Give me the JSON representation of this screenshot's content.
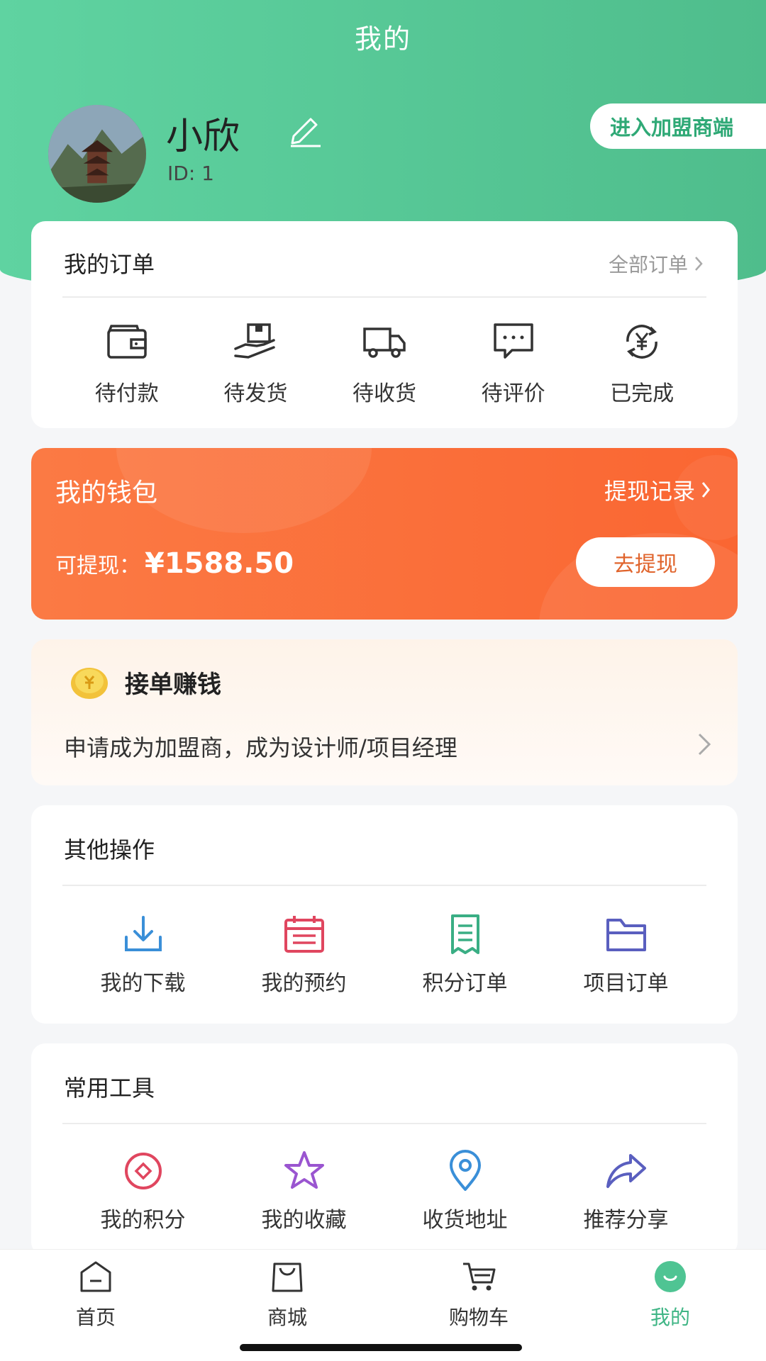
{
  "header": {
    "title": "我的",
    "user_name": "小欣",
    "user_id": "ID: 1",
    "merchant_button": "进入加盟商端"
  },
  "orders": {
    "title": "我的订单",
    "all_link": "全部订单",
    "items": [
      {
        "label": "待付款",
        "icon": "wallet-icon"
      },
      {
        "label": "待发货",
        "icon": "package-hand-icon"
      },
      {
        "label": "待收货",
        "icon": "truck-icon"
      },
      {
        "label": "待评价",
        "icon": "comment-icon"
      },
      {
        "label": "已完成",
        "icon": "yuan-refresh-icon"
      }
    ]
  },
  "wallet": {
    "title": "我的钱包",
    "record_link": "提现记录",
    "available_label": "可提现：",
    "available_value": "¥1588.50",
    "withdraw_button": "去提现"
  },
  "earn": {
    "title": "接单赚钱",
    "description": "申请成为加盟商，成为设计师/项目经理"
  },
  "other_ops": {
    "title": "其他操作",
    "items": [
      {
        "label": "我的下载",
        "icon": "download-icon",
        "color": "#3a8fd8"
      },
      {
        "label": "我的预约",
        "icon": "calendar-icon",
        "color": "#e0465f"
      },
      {
        "label": "积分订单",
        "icon": "receipt-icon",
        "color": "#3aae84"
      },
      {
        "label": "项目订单",
        "icon": "folder-icon",
        "color": "#5a5fbf"
      }
    ]
  },
  "tools": {
    "title": "常用工具",
    "items": [
      {
        "label": "我的积分",
        "icon": "points-icon",
        "color": "#e0465f"
      },
      {
        "label": "我的收藏",
        "icon": "star-icon",
        "color": "#9a55d0"
      },
      {
        "label": "收货地址",
        "icon": "location-icon",
        "color": "#3a8fd8"
      },
      {
        "label": "推荐分享",
        "icon": "share-icon",
        "color": "#5a5fbf"
      }
    ]
  },
  "tabbar": {
    "items": [
      {
        "label": "首页",
        "icon": "home-icon"
      },
      {
        "label": "商城",
        "icon": "shop-bag-icon"
      },
      {
        "label": "购物车",
        "icon": "cart-icon"
      },
      {
        "label": "我的",
        "icon": "smile-icon",
        "active": true
      }
    ],
    "active_color": "#3fb585"
  }
}
